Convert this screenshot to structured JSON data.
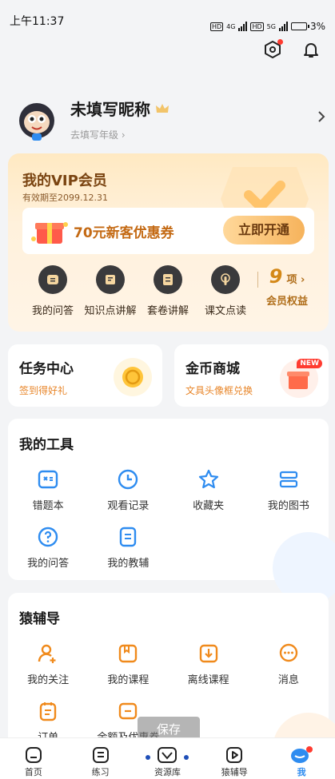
{
  "status": {
    "time": "上午11:37",
    "battery": "3%",
    "hd": "HD",
    "net1": "4G",
    "net2": "5G"
  },
  "profile": {
    "nickname": "未填写昵称",
    "grade_link": "去填写年级 ›"
  },
  "vip": {
    "title": "我的VIP会员",
    "expiry": "有效期至2099.12.31",
    "coupon": "70元新客优惠券",
    "open_button": "立即开通",
    "items": [
      {
        "label": "我的问答",
        "icon": "qa-icon"
      },
      {
        "label": "知识点讲解",
        "icon": "book-icon"
      },
      {
        "label": "套卷讲解",
        "icon": "paper-icon"
      },
      {
        "label": "课文点读",
        "icon": "touch-icon"
      }
    ],
    "benefit_count": "9",
    "benefit_unit": "项 ›",
    "benefit_label": "会员权益"
  },
  "task_center": {
    "title": "任务中心",
    "subtitle": "签到得好礼"
  },
  "coin_mall": {
    "title": "金币商城",
    "subtitle": "文具头像框兑换",
    "badge": "NEW"
  },
  "tools": {
    "title": "我的工具",
    "items": [
      {
        "label": "错题本",
        "icon": "wrong-book-icon"
      },
      {
        "label": "观看记录",
        "icon": "clock-icon"
      },
      {
        "label": "收藏夹",
        "icon": "star-icon"
      },
      {
        "label": "我的图书",
        "icon": "books-icon"
      },
      {
        "label": "我的问答",
        "icon": "question-icon"
      },
      {
        "label": "我的教辅",
        "icon": "document-icon"
      }
    ]
  },
  "tutor": {
    "title": "猿辅导",
    "items": [
      {
        "label": "我的关注",
        "icon": "follow-icon"
      },
      {
        "label": "我的课程",
        "icon": "course-icon"
      },
      {
        "label": "离线课程",
        "icon": "download-icon"
      },
      {
        "label": "消息",
        "icon": "message-icon"
      },
      {
        "label": "订单",
        "icon": "order-icon"
      },
      {
        "label": "余额及优惠券",
        "icon": "wallet-icon"
      }
    ]
  },
  "toast": "保存",
  "nav": [
    {
      "label": "首页",
      "icon": "home-icon"
    },
    {
      "label": "练习",
      "icon": "practice-icon"
    },
    {
      "label": "资源库",
      "icon": "resource-icon"
    },
    {
      "label": "猿辅导",
      "icon": "play-icon"
    },
    {
      "label": "我",
      "icon": "me-icon",
      "active": true
    }
  ],
  "colors": {
    "accent": "#2e8cf0",
    "vip_brown": "#7a4411",
    "orange": "#e8862a"
  }
}
